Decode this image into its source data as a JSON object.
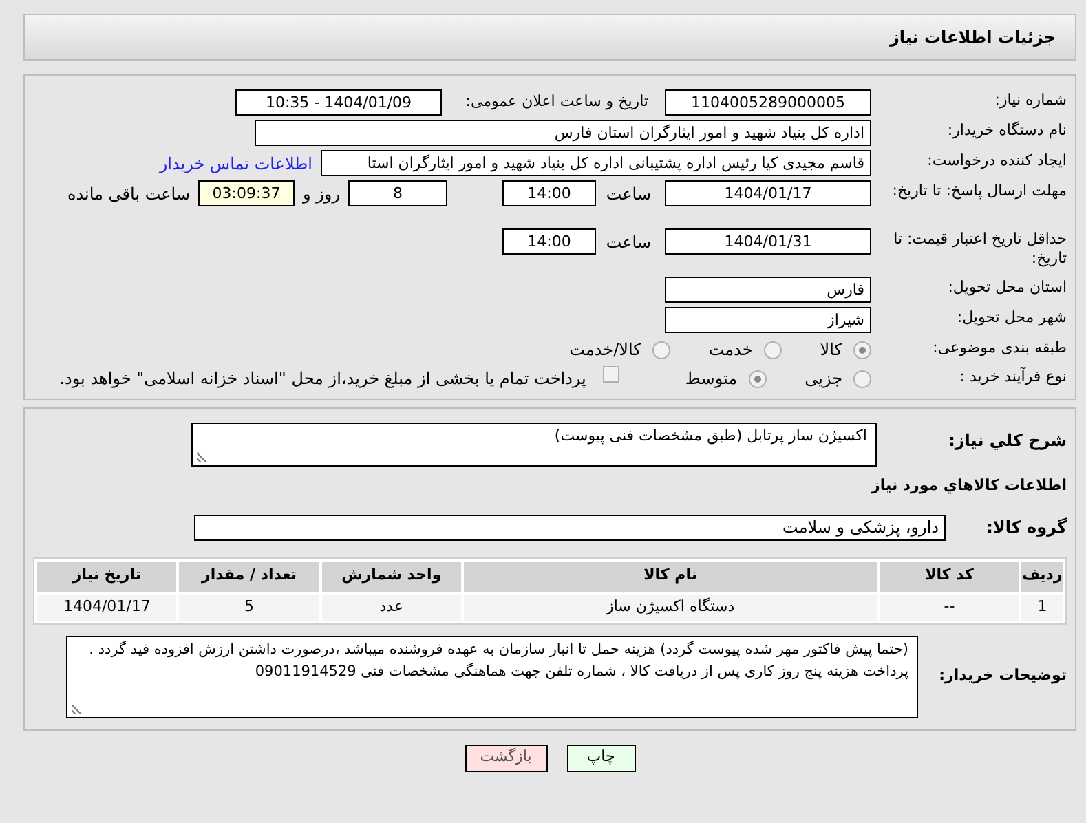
{
  "header": {
    "title": "جزئیات اطلاعات نیاز"
  },
  "need_number": {
    "label": "شماره نیاز:",
    "value": "1104005289000005"
  },
  "announce": {
    "label": "تاریخ و ساعت اعلان عمومی:",
    "value": "1404/01/09 - 10:35"
  },
  "buyer_org": {
    "label": "نام دستگاه خریدار:",
    "value": "اداره کل بنیاد شهید و امور ایثارگران استان فارس"
  },
  "requester": {
    "label": "ایجاد کننده درخواست:",
    "value": "قاسم مجیدی کیا رئیس اداره پشتیبانی اداره کل بنیاد شهید و امور ایثارگران استا",
    "link": "اطلاعات تماس خریدار"
  },
  "reply_deadline": {
    "label": "مهلت ارسال پاسخ: تا تاریخ:",
    "date": "1404/01/17",
    "time_label": "ساعت",
    "time": "14:00",
    "days": "8",
    "days_label": "روز و",
    "remaining": "03:09:37",
    "remaining_label": "ساعت باقی مانده"
  },
  "price_validity": {
    "label": "حداقل تاریخ اعتبار قیمت: تا تاریخ:",
    "date": "1404/01/31",
    "time_label": "ساعت",
    "time": "14:00"
  },
  "province": {
    "label": "استان محل تحویل:",
    "value": "فارس"
  },
  "city": {
    "label": "شهر محل تحویل:",
    "value": "شیراز"
  },
  "category": {
    "label": "طبقه بندی موضوعی:",
    "options": [
      {
        "label": "کالا",
        "selected": true
      },
      {
        "label": "خدمت",
        "selected": false
      },
      {
        "label": "کالا/خدمت",
        "selected": false
      }
    ]
  },
  "process": {
    "label": "نوع فرآیند خرید :",
    "options": [
      {
        "label": "جزیی",
        "selected": false
      },
      {
        "label": "متوسط",
        "selected": true
      }
    ],
    "payment_note": {
      "checked": false,
      "text": "پرداخت تمام یا بخشی از مبلغ خرید،از محل \"اسناد خزانه اسلامی\" خواهد بود."
    }
  },
  "description": {
    "label": "شرح کلي نياز:",
    "value": "اکسیژن ساز پرتابل (طبق مشخصات فنی پیوست)"
  },
  "goods_title": "اطلاعات کالاهاي مورد نياز",
  "goods_group": {
    "label": "گروه کالا:",
    "value": "دارو، پزشکی و سلامت"
  },
  "table": {
    "columns": [
      "ردیف",
      "کد کالا",
      "نام کالا",
      "واحد شمارش",
      "تعداد / مقدار",
      "تاریخ نیاز"
    ],
    "rows": [
      [
        "1",
        "--",
        "دستگاه اکسیژن ساز",
        "عدد",
        "5",
        "1404/01/17"
      ]
    ]
  },
  "buyer_notes": {
    "label": "توضیحات خریدار:",
    "value": "(حتما پیش فاکتور مهر شده پیوست گردد) هزینه حمل تا انبار سازمان به عهده فروشنده میباشد ،درصورت داشتن ارزش افزوده قید گردد . پرداخت هزینه پنج روز کاری پس از دریافت کالا ، شماره تلفن جهت هماهنگی مشخصات فنی 09011914529"
  },
  "buttons": [
    {
      "kind": "print",
      "label": "چاپ"
    },
    {
      "kind": "back",
      "label": "بازگشت"
    }
  ]
}
